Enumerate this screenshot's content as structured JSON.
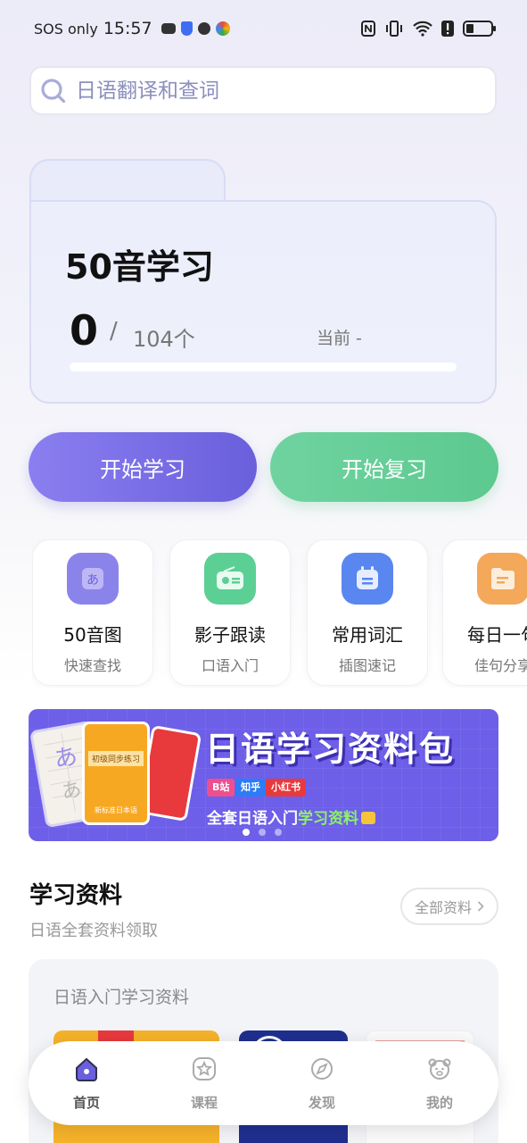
{
  "status_bar": {
    "carrier": "SOS only",
    "time": "15:57"
  },
  "search": {
    "placeholder": "日语翻译和查词"
  },
  "progress_card": {
    "title": "50音学习",
    "learned": "0",
    "separator": "/",
    "total": "104个",
    "current": "当前 -",
    "progress_fraction": 0
  },
  "actions": {
    "start_study": "开始学习",
    "start_review": "开始复习"
  },
  "tools": [
    {
      "name": "50音图",
      "sub": "快速查找",
      "icon": "kana-icon",
      "color": "#8a84ea"
    },
    {
      "name": "影子跟读",
      "sub": "口语入门",
      "icon": "radio-icon",
      "color": "#5ccf95"
    },
    {
      "name": "常用词汇",
      "sub": "插图速记",
      "icon": "calendar-icon",
      "color": "#5a86f0"
    },
    {
      "name": "每日一句",
      "sub": "佳句分享",
      "icon": "folder-icon",
      "color": "#f3a85a"
    }
  ],
  "banner": {
    "title": "日语学习资料包",
    "tags": [
      "B站",
      "知乎",
      "小红书"
    ],
    "subtitle_prefix": "全套日语入门",
    "subtitle_highlight": "学习资料",
    "book_titles": [
      "初级同步练习",
      "新标准日本语"
    ],
    "slide_count": 3,
    "active_slide": 1
  },
  "materials": {
    "title": "学习资料",
    "subtitle": "日语全套资料领取",
    "all_button": "全部资料",
    "card_title": "日语入门学习资料"
  },
  "tabbar": [
    {
      "label": "首页",
      "icon": "home-icon",
      "active": true
    },
    {
      "label": "课程",
      "icon": "star-icon",
      "active": false
    },
    {
      "label": "发现",
      "icon": "compass-icon",
      "active": false
    },
    {
      "label": "我的",
      "icon": "bear-icon",
      "active": false
    }
  ],
  "colors": {
    "accent": "#6a5fdc",
    "green": "#5cc98f",
    "banner": "#6d5fe8"
  }
}
